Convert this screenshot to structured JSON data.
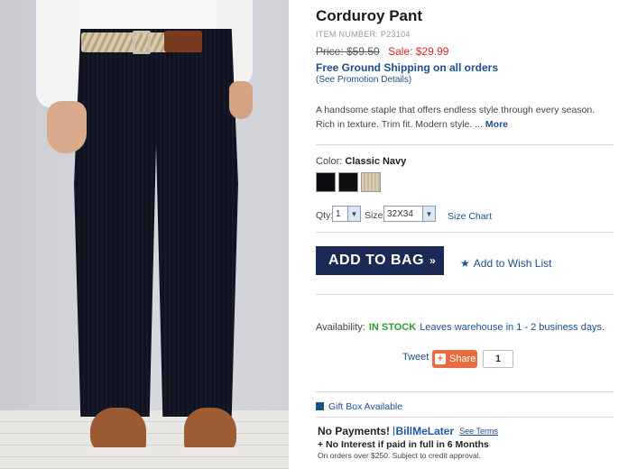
{
  "product": {
    "title": "Corduroy Pant",
    "item_number": "ITEM NUMBER: P23104",
    "original_price": "Price: $59.50",
    "sale_price": "Sale: $29.99",
    "shipping": "Free Ground Shipping on all orders",
    "promo_link": "(See Promotion Details)",
    "description": "A handsome staple that offers endless style through every season. Rich in texture. Trim fit. Modern style. ...",
    "more_link": "More"
  },
  "options": {
    "color_label": "Color:",
    "color_value": "Classic Navy",
    "swatches": [
      "#0c0d12",
      "#0f0f11",
      "#d9cdb6"
    ],
    "qty_label": "Qty:",
    "qty_value": "1",
    "size_label": "Size:",
    "size_value": "32X34",
    "size_chart": "Size Chart"
  },
  "actions": {
    "add_to_bag": "ADD TO BAG",
    "add_to_bag_arrows": "»",
    "wish_list": "Add to Wish List"
  },
  "availability": {
    "label": "Availability:",
    "status": "IN STOCK",
    "leaves": "Leaves warehouse in 1 - 2 business days."
  },
  "social": {
    "tweet": "Tweet",
    "share": "Share",
    "share_count": "1"
  },
  "gift": {
    "label": "Gift Box Available"
  },
  "bill_me_later": {
    "no_payments": "No Payments!",
    "logo_text": "BillMeLater",
    "see_terms": "See Terms",
    "line2": "+ No Interest if paid in full in 6 Months",
    "line3": "On orders over $250. Subject to credit approval."
  },
  "colors": {
    "link_blue": "#1d4f8f",
    "sale_red": "#d92727",
    "stock_green": "#2f9a2f",
    "bag_button": "#1b2a55",
    "share_orange": "#e96c41"
  }
}
